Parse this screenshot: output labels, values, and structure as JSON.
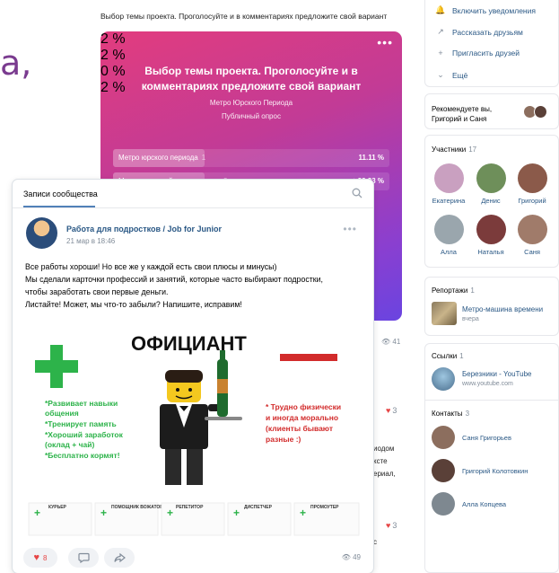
{
  "background": {
    "letter": "а,",
    "top_text": "Выбор темы проекта. Проголосуйте и в комментариях предложите свой вариант",
    "poll": {
      "title": "Выбор темы проекта. Проголосуйте и в комментариях предложите свой вариант",
      "subtitle": "Метро Юрского Периода",
      "kind": "Публичный опрос",
      "options": [
        {
          "label": "Метро юрского периода",
          "count": "1",
          "percent": "11.11 %",
          "fill": 0.33
        },
        {
          "label": "Метро палеозойского периода",
          "count": "3",
          "percent": "✓ 33.33 %",
          "fill": 0.33
        }
      ],
      "hidden_percents": [
        "2 %",
        "2 %",
        "0 %",
        "2 %"
      ]
    },
    "views": "41",
    "likes": [
      "3",
      "3"
    ],
    "text_fragments": [
      "иодом",
      "ксте",
      "ериал,",
      "с"
    ]
  },
  "sidebar": {
    "menu": [
      {
        "icon": "bell-icon",
        "glyph": "🔔",
        "label": "Включить уведомления"
      },
      {
        "icon": "share-icon",
        "glyph": "↗",
        "label": "Рассказать друзьям"
      },
      {
        "icon": "add-friend-icon",
        "glyph": "+",
        "label": "Пригласить друзей"
      },
      {
        "icon": "chevron-down-icon",
        "glyph": "⌄",
        "label": "Ещё"
      }
    ],
    "recommend": "Рекомендуете вы, Григорий и Саня",
    "members": {
      "title": "Участники",
      "count": "17",
      "people": [
        {
          "name": "Екатерина",
          "color": "#c9a0c0"
        },
        {
          "name": "Денис",
          "color": "#6e8f5a"
        },
        {
          "name": "Григорий",
          "color": "#8b5a4a"
        },
        {
          "name": "Алла",
          "color": "#9aa6ad"
        },
        {
          "name": "Наталья",
          "color": "#7b3b3b"
        },
        {
          "name": "Саня",
          "color": "#a07b6a"
        }
      ]
    },
    "reports": {
      "title": "Репортажи",
      "count": "1",
      "item_title": "Метро-машина времени",
      "item_sub": "вчера"
    },
    "links": {
      "title": "Ссылки",
      "count": "1",
      "item_title": "Березники - YouTube",
      "item_sub": "www.youtube.com"
    },
    "contacts": {
      "title": "Контакты",
      "count": "3",
      "people": [
        {
          "name": "Саня Григорьев",
          "color": "#8c6e5e"
        },
        {
          "name": "Григорий Колотовкин",
          "color": "#5a4038"
        },
        {
          "name": "Алла Копцева",
          "color": "#7e8890"
        }
      ]
    }
  },
  "post": {
    "tab": "Записи сообщества",
    "author": "Работа для подростков / Job for Junior",
    "date": "21 мар в 18:46",
    "text_lines": [
      "Все работы хороши! Но все же у каждой есть свои плюсы и минусы)",
      "Мы сделали карточки профессий и занятий, которые часто выбирают подростки,",
      "чтобы заработать свои первые деньги.",
      "Листайте! Может, мы что-то забыли? Напишите, исправим!"
    ],
    "image": {
      "heading": "ОФИЦИАНТ",
      "pros": "*Развивает навыки общения\n*Тренирует память\n*Хороший заработок (оклад + чай)\n*Бесплатно кормят!",
      "cons": "* Трудно физически и иногда морально (клиенты бывают разные :)",
      "thumbs": [
        "КУРЬЕР",
        "ПОМОЩНИК ВОЖАТОГО",
        "РЕПЕТИТОР",
        "ДИСПЕТЧЕР",
        "ПРОМОУТЕР"
      ]
    },
    "likes": "8",
    "views": "49"
  }
}
